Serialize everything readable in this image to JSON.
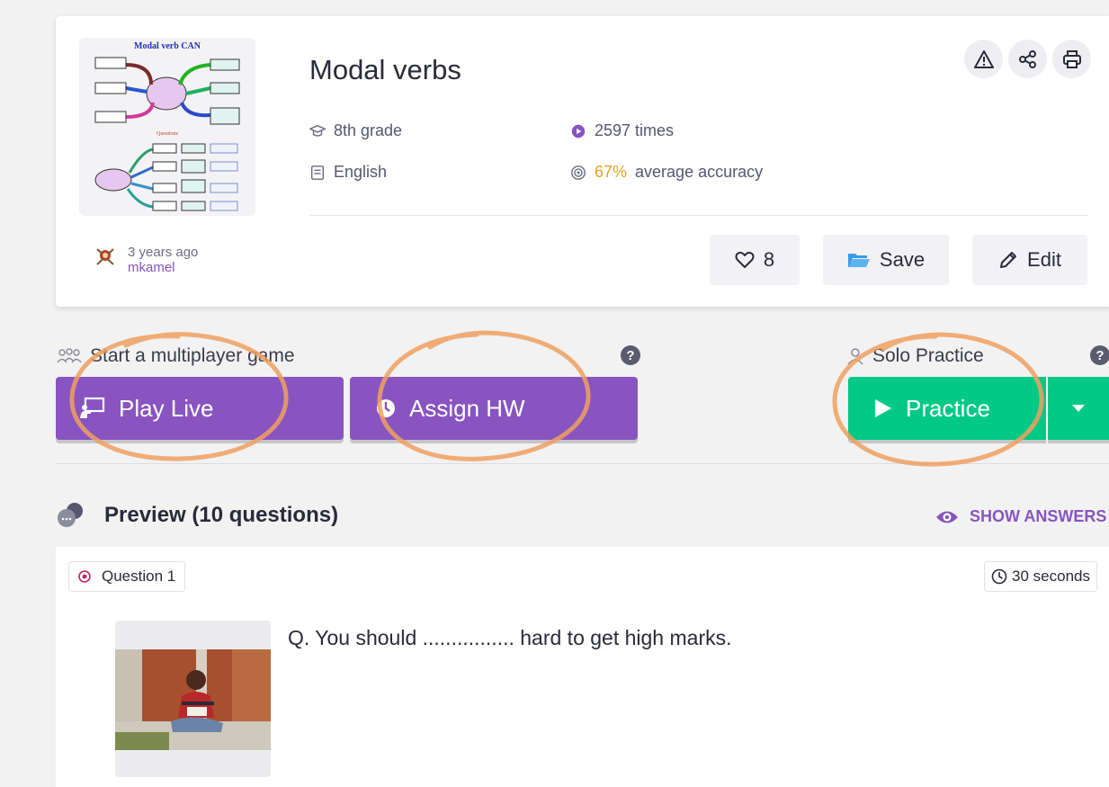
{
  "quiz": {
    "title": "Modal verbs",
    "thumbnail_title": "Modal verb CAN",
    "grade": "8th grade",
    "subject": "English",
    "plays": "2597 times",
    "accuracy_value": "67%",
    "accuracy_label": "average accuracy",
    "author_age": "3 years ago",
    "author_name": "mkamel"
  },
  "top_icons": [
    "report-icon",
    "share-icon",
    "print-icon"
  ],
  "actions": {
    "like_count": "8",
    "save_label": "Save",
    "edit_label": "Edit"
  },
  "multiplayer": {
    "label": "Start a multiplayer game",
    "play_live_label": "Play Live",
    "assign_hw_label": "Assign HW"
  },
  "solo": {
    "label": "Solo Practice",
    "practice_label": "Practice"
  },
  "preview": {
    "heading": "Preview (10 questions)",
    "show_answers_label": "SHOW ANSWERS"
  },
  "question": {
    "number_label": "Question 1",
    "time_label": "30 seconds",
    "text": "Q. You should ................ hard to get high marks."
  },
  "colors": {
    "brand_purple": "#8854c0",
    "practice_green": "#00c985",
    "accuracy_orange": "#e4a31e",
    "annotation_orange": "#f0a060"
  }
}
